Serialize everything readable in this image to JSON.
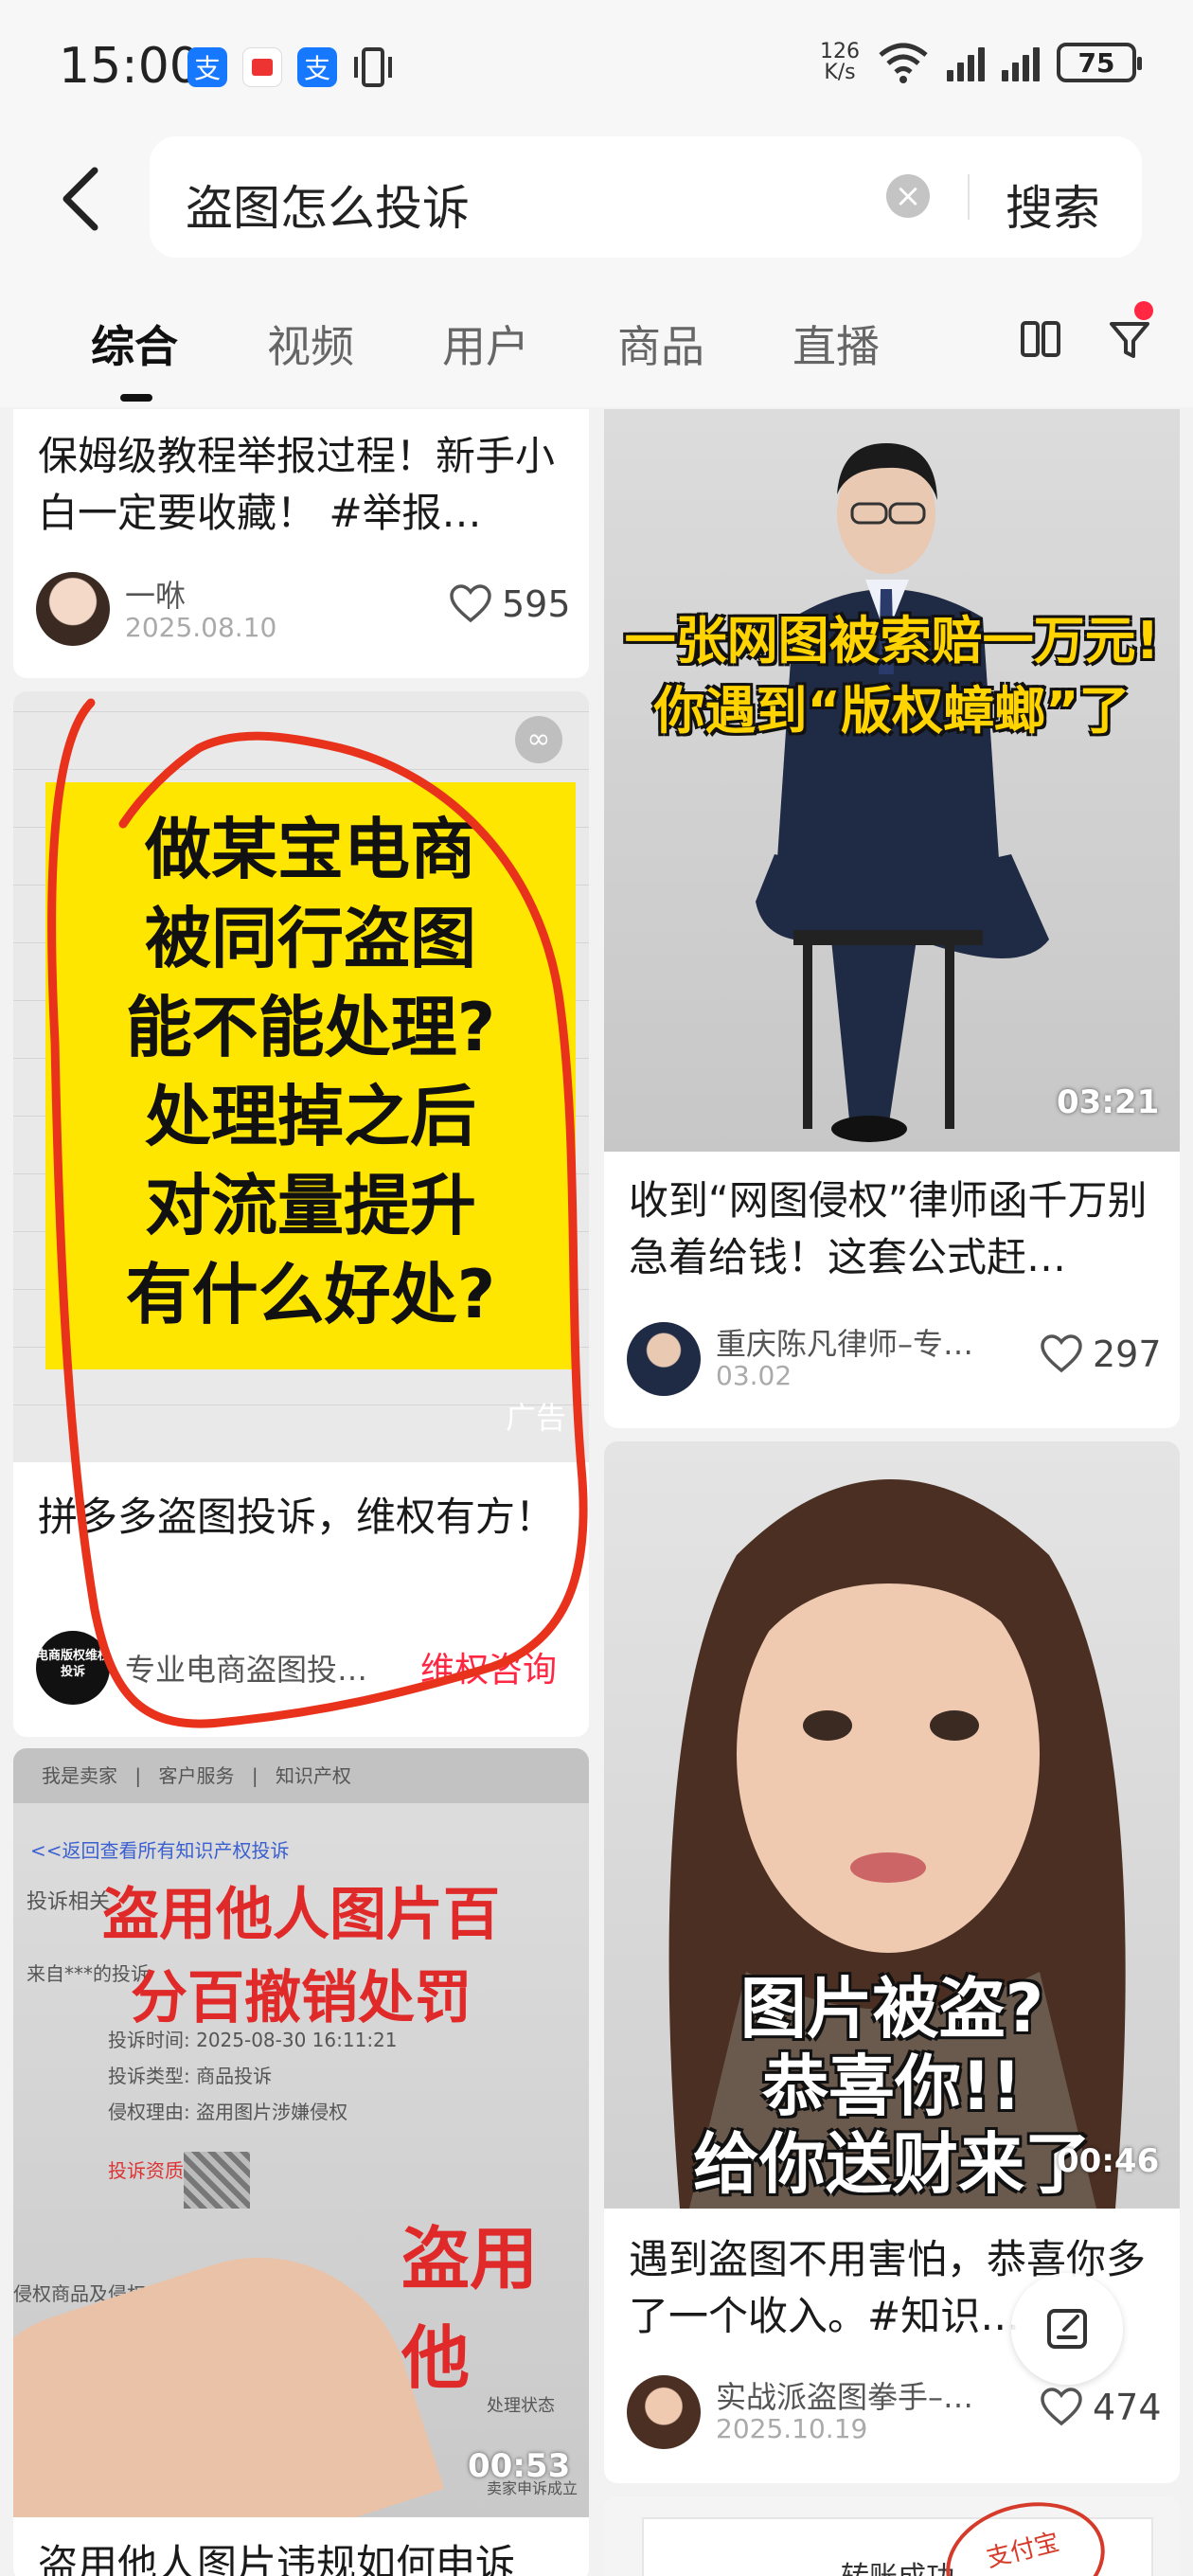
{
  "status_bar": {
    "time": "15:00",
    "net_speed_value": "126",
    "net_speed_unit": "K/s",
    "battery": "75",
    "icons": [
      "alipay-icon",
      "red-app-icon",
      "alipay-icon",
      "vibrate-icon",
      "wifi-icon",
      "signal-icon"
    ]
  },
  "search": {
    "query": "盗图怎么投诉",
    "button": "搜索"
  },
  "tabs": [
    {
      "label": "综合",
      "active": true
    },
    {
      "label": "视频",
      "active": false
    },
    {
      "label": "用户",
      "active": false
    },
    {
      "label": "商品",
      "active": false
    },
    {
      "label": "直播",
      "active": false
    }
  ],
  "feed": {
    "left": [
      {
        "title": "保姆级教程举报过程！新手小白一定要收藏！ #举报…",
        "author": "一咻",
        "date": "2025.08.10",
        "likes": "595"
      },
      {
        "cover_text": [
          "做某宝电商",
          "被同行盗图",
          "能不能处理?",
          "处理掉之后",
          "对流量提升",
          "有什么好处?"
        ],
        "ad_label": "广告",
        "title": "拼多多盗图投诉，维权有方！",
        "author": "专业电商盗图投…",
        "avatar_text": "电商版权维权投诉",
        "cta": "维权咨询"
      },
      {
        "cover_text": [
          "盗用他人图片百",
          "分百撤销处罚"
        ],
        "cover_side_text": "盗用他",
        "screenshot_lines": [
          "我是卖家",
          "客户服务",
          "知识产权",
          "<<返回查看所有知识产权投诉",
          "投诉相关",
          "来自***的投诉",
          "投诉时间: 2025-08-30 16:11:21",
          "投诉类型: 商品投诉",
          "侵权理由: 盗用图片涉嫌侵权",
          "投诉资质:",
          "侵权商品及侵权",
          "处理状态",
          "卖家申诉成立"
        ],
        "duration": "00:53",
        "title": "盗用他人图片违规如何申诉"
      }
    ],
    "right": [
      {
        "cover_text": [
          "一张网图被索赔一万元!",
          "你遇到“版权蟑螂”了"
        ],
        "duration": "03:21",
        "title": "收到“网图侵权”律师函千万别急着给钱！这套公式赶…",
        "author": "重庆陈凡律师–专…",
        "date": "03.02",
        "likes": "297"
      },
      {
        "cover_text": [
          "图片被盗?",
          "恭喜你!!",
          "给你送财来了"
        ],
        "duration": "00:46",
        "title": "遇到盗图不用害怕，恭喜你多了一个收入。#知识…",
        "author": "实战派盗图拳手–…",
        "date": "2025.10.19",
        "likes": "474"
      },
      {
        "cover_text": [
          "转账成功",
          "支付宝"
        ]
      }
    ]
  },
  "colors": {
    "accent_red": "#ff2742",
    "annotation_red": "#e8321c",
    "yellow_cover": "#ffe600"
  }
}
